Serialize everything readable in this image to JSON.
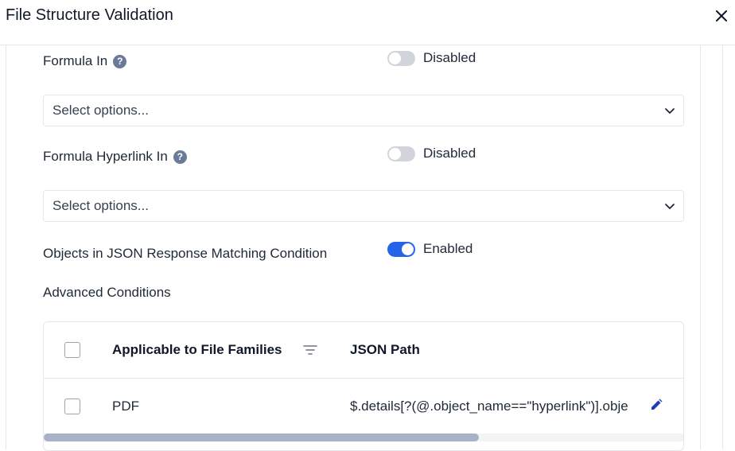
{
  "modal": {
    "title": "File Structure Validation"
  },
  "sections": {
    "formula_in": {
      "label": "Formula In",
      "toggle_label": "Disabled",
      "select_placeholder": "Select options..."
    },
    "formula_hyperlink_in": {
      "label": "Formula Hyperlink In",
      "toggle_label": "Disabled",
      "select_placeholder": "Select options..."
    },
    "objects_json": {
      "label": "Objects in JSON Response Matching Condition",
      "toggle_label": "Enabled"
    },
    "advanced": {
      "label": "Advanced Conditions"
    }
  },
  "table": {
    "columns": [
      "Applicable to File Families",
      "JSON Path"
    ],
    "rows": [
      {
        "family": "PDF",
        "json_path": "$.details[?(@.object_name==\"hyperlink\")].object"
      }
    ],
    "horizontal_scroll_fraction": 0.68
  },
  "colors": {
    "accent": "#2563eb",
    "toggle_off": "#d1d5db",
    "help_icon": "#6b7a99",
    "edit_icon": "#1e40af"
  },
  "icons": {
    "close": "close-icon",
    "help": "help-icon",
    "chevron": "chevron-down-icon",
    "filter": "filter-icon",
    "edit": "edit-icon"
  }
}
